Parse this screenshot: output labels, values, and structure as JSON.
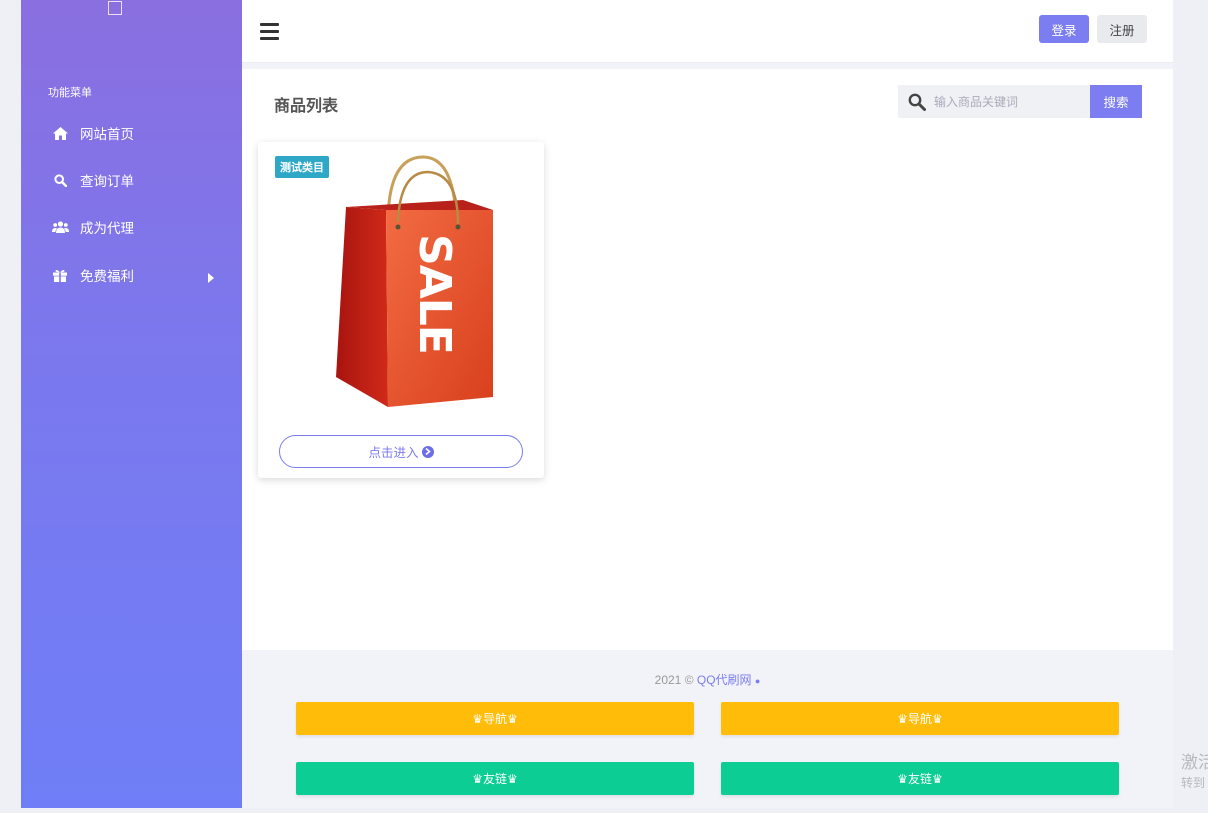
{
  "sidebar": {
    "menu_title": "功能菜单",
    "items": [
      {
        "label": "网站首页",
        "icon": "home-icon"
      },
      {
        "label": "查询订单",
        "icon": "search-icon"
      },
      {
        "label": "成为代理",
        "icon": "users-icon"
      },
      {
        "label": "免费福利",
        "icon": "gift-icon"
      }
    ]
  },
  "header": {
    "login_label": "登录",
    "register_label": "注册"
  },
  "main": {
    "title": "商品列表",
    "search": {
      "placeholder": "输入商品关键词",
      "button_label": "搜索"
    },
    "products": [
      {
        "category_badge": "测试类目",
        "bag_text": "SALE",
        "enter_label": "点击进入"
      }
    ]
  },
  "footer": {
    "year": "2021",
    "copyright_symbol": "©",
    "site_name": "QQ代刷网",
    "dot": "●",
    "buttons": [
      {
        "label": "♛导航♛",
        "color": "#ffbd09"
      },
      {
        "label": "♛导航♛",
        "color": "#ffbd09"
      },
      {
        "label": "♛友链♛",
        "color": "#0ccd94"
      },
      {
        "label": "♛友链♛",
        "color": "#0ccd94"
      }
    ]
  },
  "watermark": {
    "line1": "激活",
    "line2": "转到"
  },
  "colors": {
    "accent": "#7c7df0",
    "badge": "#2fa8c7",
    "yellow": "#ffbd09",
    "green": "#0ccd94"
  }
}
